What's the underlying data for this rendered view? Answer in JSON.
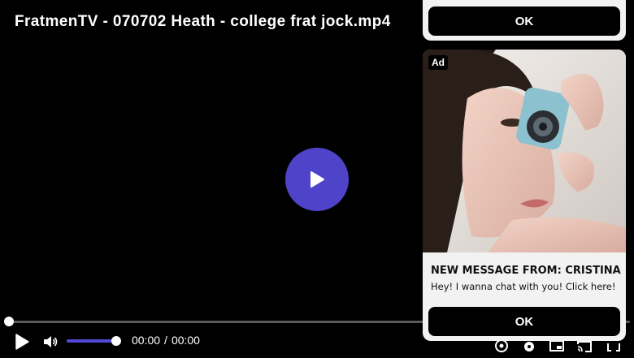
{
  "player": {
    "title": "FratmenTV - 070702 Heath - college frat jock.mp4",
    "accent_color": "#4f44c9",
    "progress": 0,
    "volume": 1,
    "time": {
      "current": "00:00",
      "separator": "/",
      "duration": "00:00"
    },
    "icons": [
      "play-icon",
      "volume-icon",
      "chromecast-icon",
      "settings-icon",
      "pip-icon",
      "cast-icon",
      "fullscreen-icon"
    ]
  },
  "ads": {
    "top": {
      "button_label": "OK"
    },
    "card": {
      "badge": "Ad",
      "headline": "NEW MESSAGE FROM: CRISTINA",
      "body": "Hey! I wanna chat with you! Click here!",
      "button_label": "OK"
    }
  }
}
